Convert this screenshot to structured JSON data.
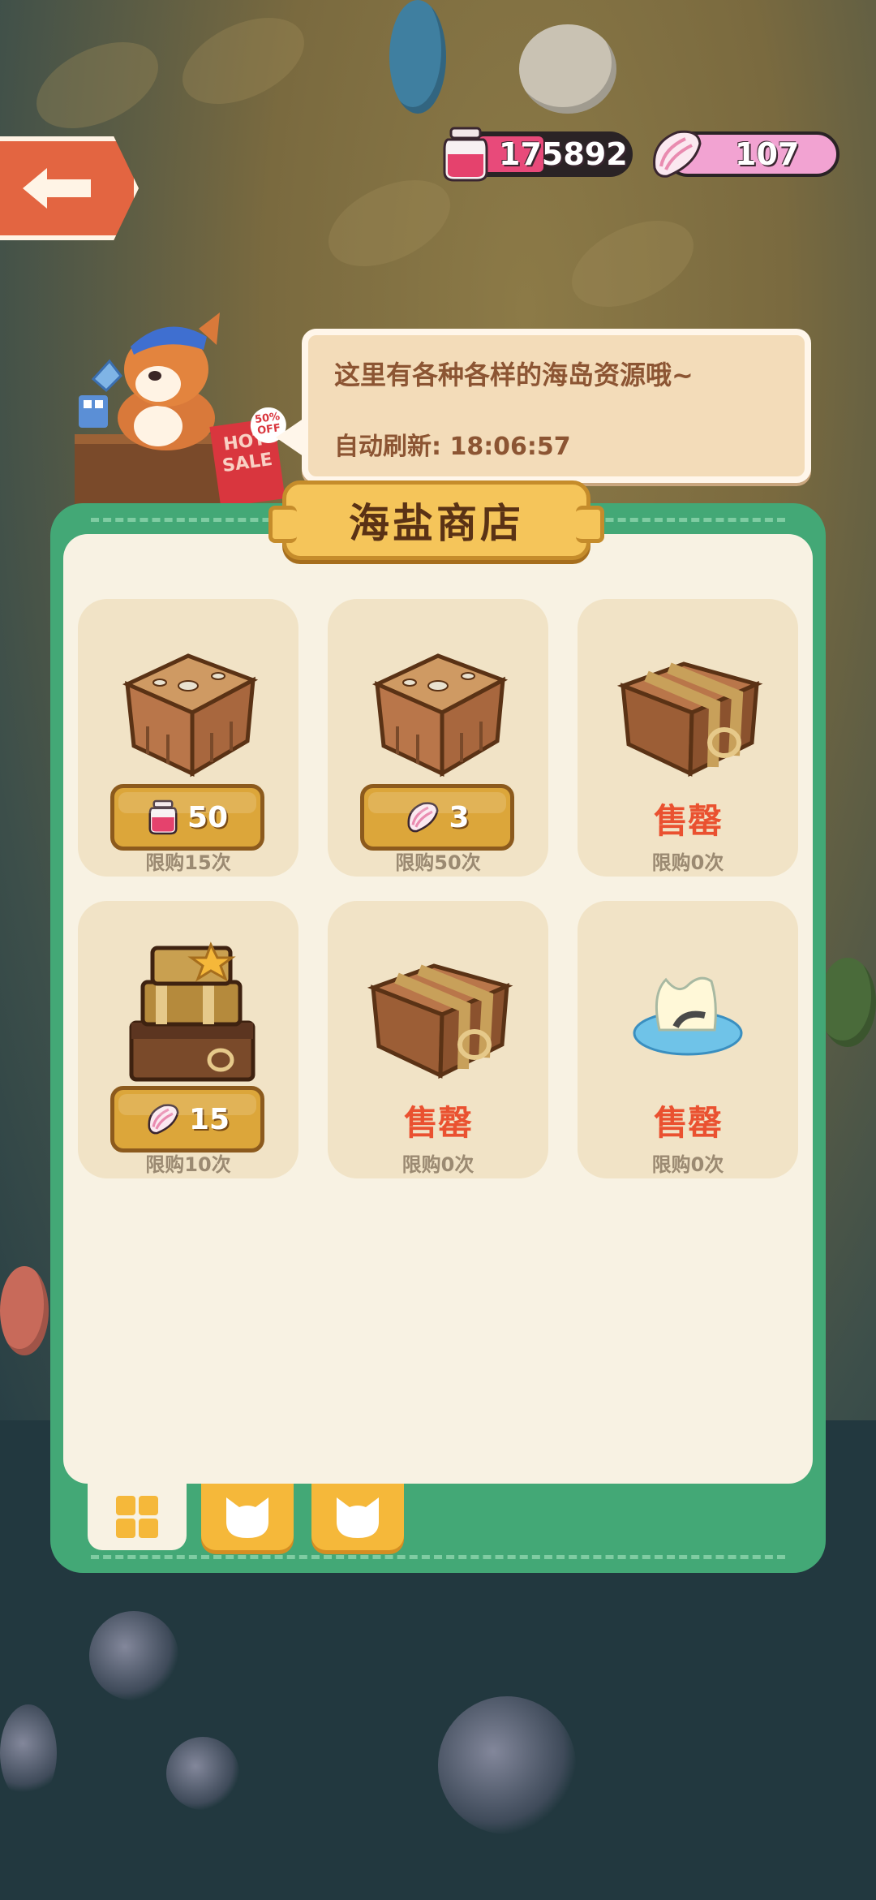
{
  "currencies": {
    "jam": {
      "icon": "jam-jar-icon",
      "value": "175892"
    },
    "shell": {
      "icon": "pink-shell-icon",
      "value": "107"
    }
  },
  "shopkeeper": {
    "hot_sale_badge": "50% OFF",
    "hot_sale_text": "HOT SALE",
    "speech": "这里有各种各样的海岛资源哦~",
    "refresh_label": "自动刷新: 18:06:57"
  },
  "shop": {
    "title": "海盐商店",
    "items": [
      {
        "image": "wooden-crate-icon",
        "price_icon": "jam-jar-icon",
        "price": "50",
        "limit": "限购15次",
        "sold_out": false
      },
      {
        "image": "wooden-crate-icon",
        "price_icon": "pink-shell-icon",
        "price": "3",
        "limit": "限购50次",
        "sold_out": false
      },
      {
        "image": "strapped-crate-icon",
        "sold_label": "售罄",
        "limit": "限购0次",
        "sold_out": true
      },
      {
        "image": "treasure-chest-stack-icon",
        "price_icon": "pink-shell-icon",
        "price": "15",
        "limit": "限购10次",
        "sold_out": false
      },
      {
        "image": "strapped-crate-icon",
        "sold_label": "售罄",
        "limit": "限购0次",
        "sold_out": true
      },
      {
        "image": "salt-puddle-icon",
        "sold_label": "售罄",
        "limit": "限购0次",
        "sold_out": true
      }
    ]
  },
  "tabs": [
    {
      "icon": "grid-icon",
      "active": true
    },
    {
      "icon": "cat-face-icon",
      "active": false
    },
    {
      "icon": "cat-face-icon",
      "active": false
    }
  ],
  "colors": {
    "panel_green": "#43a876",
    "panel_cream": "#f8f2e3",
    "price_gold": "#dca63a",
    "sold_red": "#ea5130",
    "back_orange": "#e36541"
  }
}
